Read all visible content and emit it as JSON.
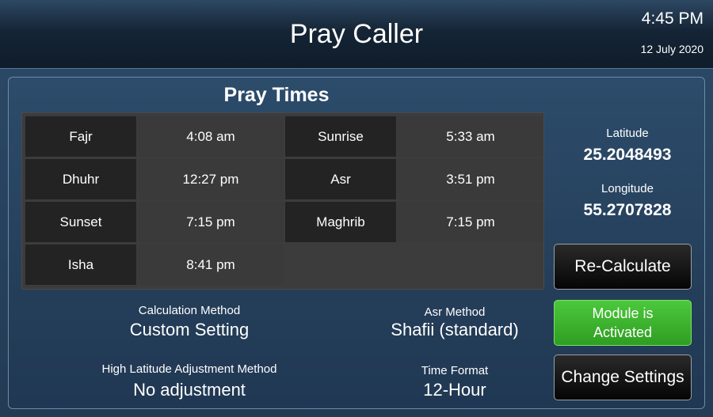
{
  "header": {
    "title": "Pray Caller",
    "time": "4:45 PM",
    "date": "12 July 2020"
  },
  "panel": {
    "title": "Pray Times"
  },
  "prayers": [
    {
      "name": "Fajr",
      "time": "4:08 am"
    },
    {
      "name": "Sunrise",
      "time": "5:33 am"
    },
    {
      "name": "Dhuhr",
      "time": "12:27 pm"
    },
    {
      "name": "Asr",
      "time": "3:51 pm"
    },
    {
      "name": "Sunset",
      "time": "7:15 pm"
    },
    {
      "name": "Maghrib",
      "time": "7:15 pm"
    },
    {
      "name": "Isha",
      "time": "8:41 pm"
    }
  ],
  "location": {
    "latitude_label": "Latitude",
    "latitude": "25.2048493",
    "longitude_label": "Longitude",
    "longitude": "55.2707828"
  },
  "buttons": {
    "recalculate": "Re-Calculate",
    "module_line1": "Module is",
    "module_line2": "Activated",
    "change_settings": "Change Settings"
  },
  "settings": {
    "calc_method_label": "Calculation Method",
    "calc_method": "Custom Setting",
    "asr_method_label": "Asr Method",
    "asr_method": "Shafii (standard)",
    "high_lat_label": "High Latitude Adjustment Method",
    "high_lat": "No adjustment",
    "time_format_label": "Time Format",
    "time_format": "12-Hour"
  },
  "colors": {
    "active_green": "#3cb52d",
    "background": "#2b4a68"
  }
}
